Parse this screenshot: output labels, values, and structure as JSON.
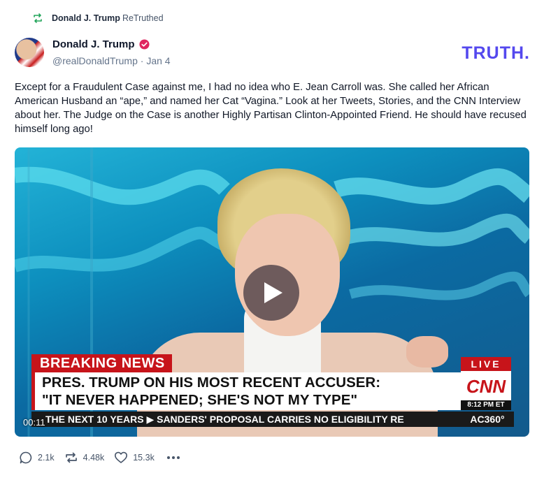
{
  "retruth": {
    "user": "Donald J. Trump",
    "action": "ReTruthed"
  },
  "post": {
    "author_name": "Donald J. Trump",
    "handle": "@realDonaldTrump",
    "separator": "·",
    "date": "Jan 4",
    "text": "Except for a Fraudulent Case against me, I had no idea who E. Jean Carroll was. She called her African American Husband an “ape,” and named her Cat “Vagina.” Look at her Tweets, Stories, and the CNN Interview about her. The Judge on the Case is another Highly Partisan Clinton-Appointed Friend. He should have recused himself long ago!"
  },
  "brand": {
    "logo_text": "TRUTH.",
    "color": "#5448ee"
  },
  "video": {
    "breaking": "BREAKING NEWS",
    "headline_line1": "PRES. TRUMP ON HIS MOST RECENT ACCUSER:",
    "headline_line2": "\"IT NEVER HAPPENED; SHE'S NOT MY TYPE\"",
    "live": "LIVE",
    "network": "CNN",
    "time": "8:12 PM ET",
    "ticker": "THE NEXT 10 YEARS  ▶  SANDERS' PROPOSAL CARRIES NO ELIGIBILITY RE",
    "show": "AC360°",
    "timestamp": "00:11"
  },
  "actions": {
    "replies": "2.1k",
    "retruths": "4.48k",
    "likes": "15.3k"
  },
  "icons": [
    "retruth-icon",
    "verified-icon",
    "play-icon",
    "reply-icon",
    "retruth-icon",
    "like-icon",
    "more-icon"
  ]
}
